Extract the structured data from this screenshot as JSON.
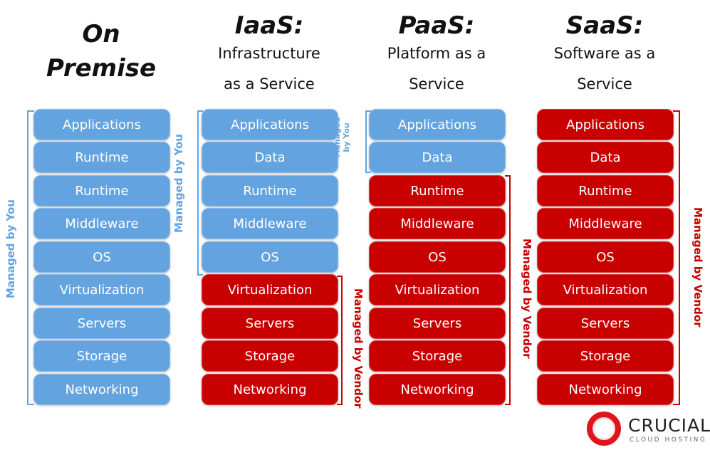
{
  "colors": {
    "you": "#63a3df",
    "vendor": "#c80000"
  },
  "columns": [
    {
      "title": "On",
      "title2": "Premise",
      "subtitle": "",
      "subtitle2": "",
      "layers": [
        [
          "Applications",
          "you"
        ],
        [
          "Runtime",
          "you"
        ],
        [
          "Runtime",
          "you"
        ],
        [
          "Middleware",
          "you"
        ],
        [
          "OS",
          "you"
        ],
        [
          "Virtualization",
          "you"
        ],
        [
          "Servers",
          "you"
        ],
        [
          "Storage",
          "you"
        ],
        [
          "Networking",
          "you"
        ]
      ]
    },
    {
      "title": "IaaS:",
      "subtitle": "Infrastructure",
      "subtitle2": "as a Service",
      "layers": [
        [
          "Applications",
          "you"
        ],
        [
          "Data",
          "you"
        ],
        [
          "Runtime",
          "you"
        ],
        [
          "Middleware",
          "you"
        ],
        [
          "OS",
          "you"
        ],
        [
          "Virtualization",
          "vendor"
        ],
        [
          "Servers",
          "vendor"
        ],
        [
          "Storage",
          "vendor"
        ],
        [
          "Networking",
          "vendor"
        ]
      ]
    },
    {
      "title": "PaaS:",
      "subtitle": "Platform as a",
      "subtitle2": "Service",
      "layers": [
        [
          "Applications",
          "you"
        ],
        [
          "Data",
          "you"
        ],
        [
          "Runtime",
          "vendor"
        ],
        [
          "Middleware",
          "vendor"
        ],
        [
          "OS",
          "vendor"
        ],
        [
          "Virtualization",
          "vendor"
        ],
        [
          "Servers",
          "vendor"
        ],
        [
          "Storage",
          "vendor"
        ],
        [
          "Networking",
          "vendor"
        ]
      ]
    },
    {
      "title": "SaaS:",
      "subtitle": "Software as a",
      "subtitle2": "Service",
      "layers": [
        [
          "Applications",
          "vendor"
        ],
        [
          "Data",
          "vendor"
        ],
        [
          "Runtime",
          "vendor"
        ],
        [
          "Middleware",
          "vendor"
        ],
        [
          "OS",
          "vendor"
        ],
        [
          "Virtualization",
          "vendor"
        ],
        [
          "Servers",
          "vendor"
        ],
        [
          "Storage",
          "vendor"
        ],
        [
          "Networking",
          "vendor"
        ]
      ]
    }
  ],
  "labels": {
    "managed_by_you": "Managed by You",
    "managed": "Managed",
    "by_you": "by You",
    "managed_by_vendor": "Managed by Vendor"
  },
  "logo": {
    "name": "CRUCIAL",
    "tagline": "CLOUD HOSTING",
    "icon": "red-ring-logo"
  }
}
